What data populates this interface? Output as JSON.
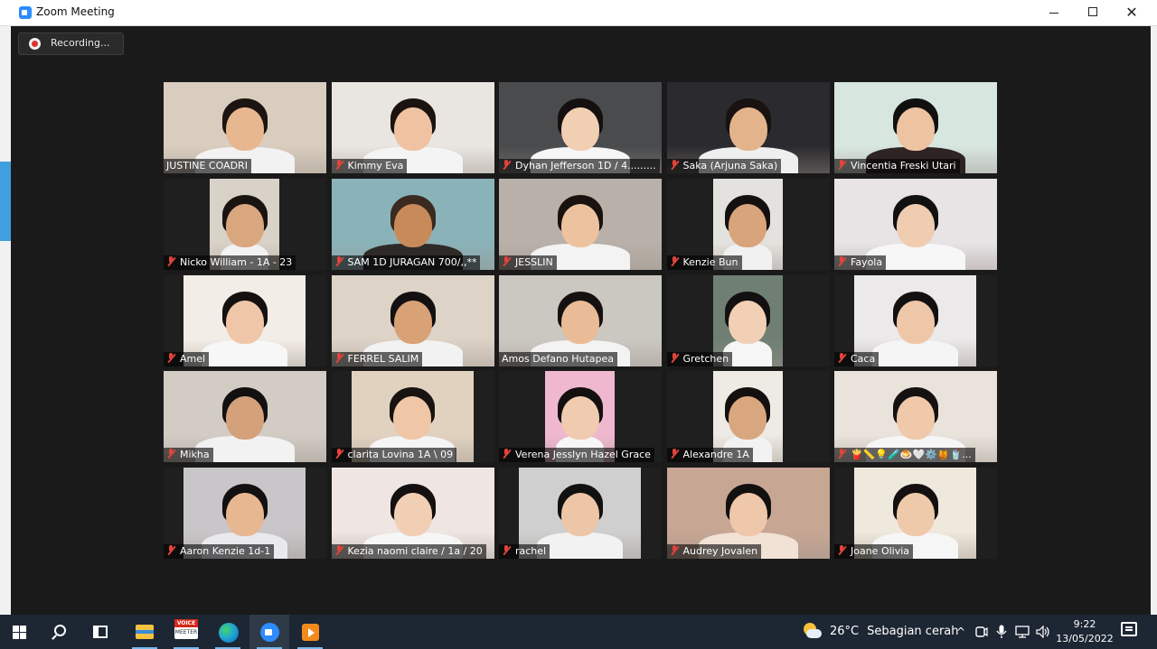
{
  "window": {
    "title": "Zoom Meeting",
    "minimize_glyph": "",
    "close_glyph": "✕"
  },
  "meeting": {
    "recording_label": "Recording...",
    "participants": [
      {
        "name": "JUSTINE COADRI",
        "muted": false,
        "bg": "#d9cdbf",
        "skin": "#e7b78f",
        "shirt": "#f2f2f2",
        "hair": "#1c1410"
      },
      {
        "name": "Kimmy Eva",
        "muted": true,
        "bg": "#e9e5e1",
        "skin": "#efc3a1",
        "shirt": "#f4f4f4",
        "hair": "#1b1310"
      },
      {
        "name": "Dyhan Jefferson 1D / 4.........",
        "muted": true,
        "bg": "#4a4b4d",
        "skin": "#f1cfb2",
        "shirt": "#f6f6f6",
        "hair": "#141010"
      },
      {
        "name": "Saka (Arjuna Saka)",
        "muted": true,
        "bg": "#2b2a2e",
        "skin": "#e3b38b",
        "shirt": "#efefef",
        "hair": "#181210"
      },
      {
        "name": "Vincentia Freski Utari",
        "muted": true,
        "bg": "#d7e6df",
        "skin": "#edc3a2",
        "shirt": "#2e2424",
        "hair": "#111010"
      },
      {
        "name": "Nicko William - 1A - 23",
        "muted": true,
        "bg": "#d9d2c8",
        "skin": "#d9a77e",
        "shirt": "#f2f2f2",
        "hair": "#1a1411"
      },
      {
        "name": "SAM 1D JURAGAN 700/,,**",
        "muted": true,
        "bg": "#8ab3b9",
        "skin": "#c98a5a",
        "shirt": "#2e2a28",
        "hair": "#3a2a20"
      },
      {
        "name": "JESSLIN",
        "muted": true,
        "bg": "#b9b1a9",
        "skin": "#edc39f",
        "shirt": "#f3f3f3",
        "hair": "#1a120f"
      },
      {
        "name": "Kenzie Bun",
        "muted": true,
        "bg": "#e4e2de",
        "skin": "#d8a47b",
        "shirt": "#f1f1f1",
        "hair": "#151010"
      },
      {
        "name": "Fayola",
        "muted": true,
        "bg": "#e8e4e6",
        "skin": "#f0ccb1",
        "shirt": "#f7f7f7",
        "hair": "#111"
      },
      {
        "name": "Amel",
        "muted": true,
        "bg": "#f2ede6",
        "skin": "#efc7a8",
        "shirt": "#f7f7f7",
        "hair": "#151110"
      },
      {
        "name": "FERREL SALIM",
        "muted": true,
        "bg": "#ddd3c7",
        "skin": "#d8a176",
        "shirt": "#f2f2f2",
        "hair": "#121010"
      },
      {
        "name": "Amos Defano Hutapea",
        "muted": false,
        "bg": "#cbc8c2",
        "skin": "#e9bb97",
        "shirt": "#f3f3f3",
        "hair": "#161110"
      },
      {
        "name": "Gretchen",
        "muted": true,
        "bg": "#6f7f74",
        "skin": "#f1d0b6",
        "shirt": "#f6f6f6",
        "hair": "#121010"
      },
      {
        "name": "Caca",
        "muted": true,
        "bg": "#ece9ea",
        "skin": "#eec7a8",
        "shirt": "#f5f5f5",
        "hair": "#131010"
      },
      {
        "name": "Mikha",
        "muted": true,
        "bg": "#d2ccc5",
        "skin": "#d4a17a",
        "shirt": "#f2f2f2",
        "hair": "#121010"
      },
      {
        "name": "clarita Lovina 1A \\ 09",
        "muted": true,
        "bg": "#e1d2c0",
        "skin": "#efc6a6",
        "shirt": "#f5f5f5",
        "hair": "#181210"
      },
      {
        "name": "Verena Jesslyn Hazel Grace",
        "muted": true,
        "bg": "#efb8cf",
        "skin": "#f0cbb0",
        "shirt": "#f6f6f6",
        "hair": "#141010"
      },
      {
        "name": "Alexandre 1A",
        "muted": true,
        "bg": "#eeeae4",
        "skin": "#d9a77f",
        "shirt": "#f2f2f2",
        "hair": "#141010"
      },
      {
        "name": "🍟📏💡🧪🍮🤍⚙️🍯🥤...",
        "muted": true,
        "bg": "#e9e3dc",
        "skin": "#f0c9aa",
        "shirt": "#f6f6f6",
        "hair": "#151110"
      },
      {
        "name": "Aaron Kenzie 1d-1",
        "muted": true,
        "bg": "#c8c6c9",
        "skin": "#e7b792",
        "shirt": "#e9e9ee",
        "hair": "#121010"
      },
      {
        "name": "Kezia naomi claire / 1a / 20",
        "muted": true,
        "bg": "#efe6e3",
        "skin": "#f1cfb5",
        "shirt": "#f6f6f6",
        "hair": "#141010"
      },
      {
        "name": "rachel",
        "muted": true,
        "bg": "#cfcfcf",
        "skin": "#edc6a7",
        "shirt": "#f2f2f2",
        "hair": "#111"
      },
      {
        "name": "Audrey Jovalen",
        "muted": true,
        "bg": "#c7a694",
        "skin": "#efc7aa",
        "shirt": "#f2e2d6",
        "hair": "#131010"
      },
      {
        "name": "Joane Olivia",
        "muted": true,
        "bg": "#efe8dc",
        "skin": "#efcaaa",
        "shirt": "#f6f6f6",
        "hair": "#141010"
      }
    ]
  },
  "taskbar": {
    "start_icon": "windows-logo",
    "voicemeeter_top": "VOICE",
    "voicemeeter_bottom": "MEETER",
    "weather_temp": "26°C",
    "weather_desc": "Sebagian cerah",
    "tray_chevron": "^",
    "tray_icons": [
      "chevron-up-icon",
      "meet-now-icon",
      "microphone-icon",
      "network-icon",
      "speaker-icon"
    ],
    "time": "9:22",
    "date": "13/05/2022"
  }
}
